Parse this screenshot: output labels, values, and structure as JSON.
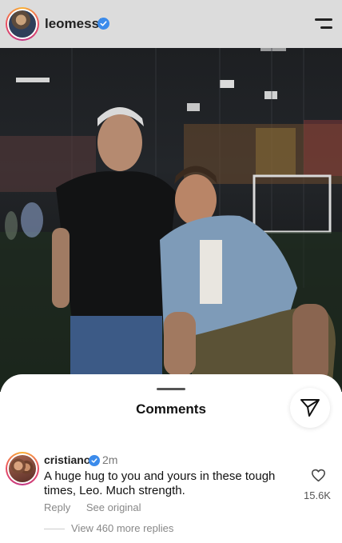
{
  "header": {
    "username": "leomessi",
    "verified": true,
    "menu_icon": "hamburger-menu-icon"
  },
  "post": {
    "image": "photo"
  },
  "comments_sheet": {
    "title": "Comments",
    "share_icon": "paper-plane-icon",
    "comment": {
      "username": "cristiano",
      "verified": true,
      "time": "2m",
      "text": "A huge hug to you and yours in these tough times, Leo. Much strength.",
      "reply_label": "Reply",
      "see_original_label": "See original",
      "like_icon": "heart-icon",
      "like_count": "15.6K",
      "view_replies_label": "View 460 more replies"
    }
  },
  "colors": {
    "verified_blue": "#3b8beb",
    "topbar_bg": "#dcdcdc"
  }
}
